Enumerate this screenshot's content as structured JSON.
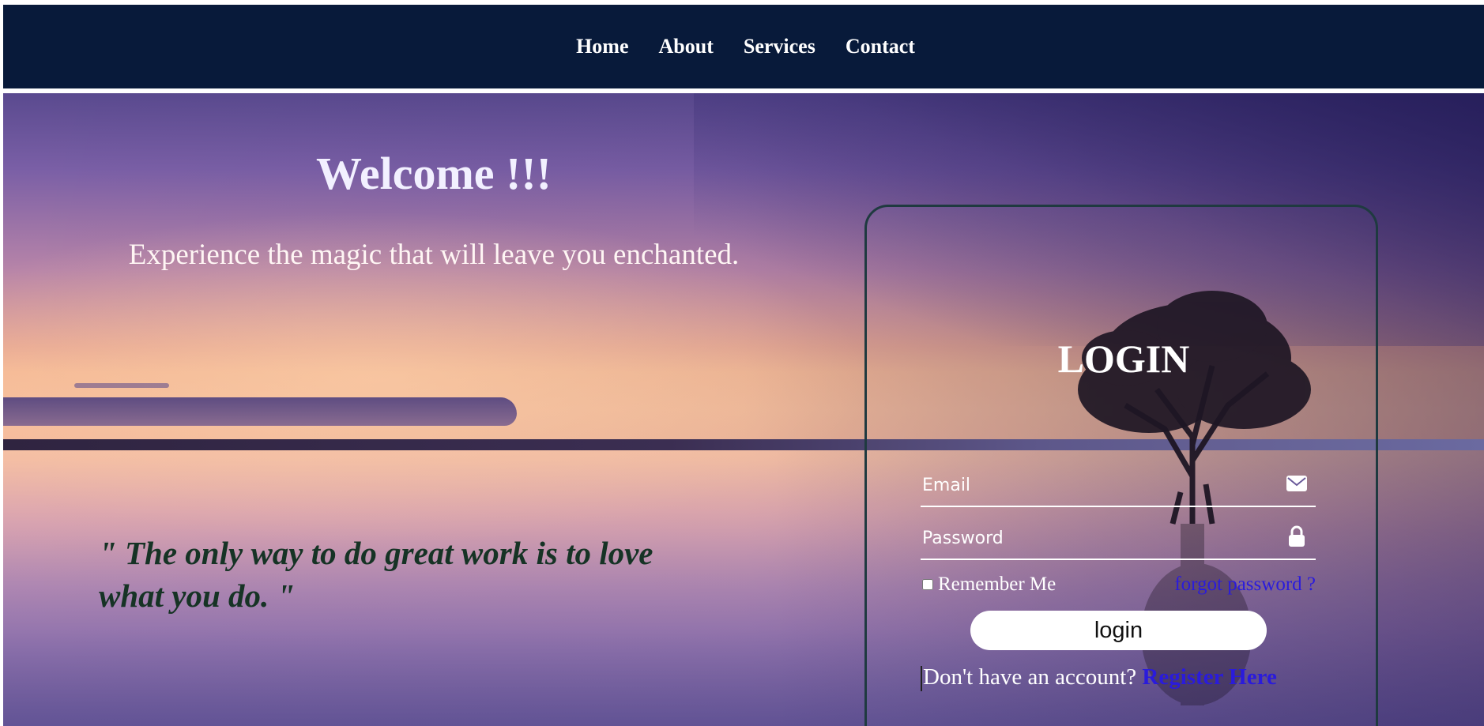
{
  "nav": {
    "items": [
      {
        "label": "Home"
      },
      {
        "label": "About"
      },
      {
        "label": "Services"
      },
      {
        "label": "Contact"
      }
    ]
  },
  "hero": {
    "title": "Welcome !!!",
    "tagline": "Experience the magic that will leave you enchanted.",
    "quote": "\" The only way to do great work is to love what you do. \""
  },
  "login": {
    "title": "LOGIN",
    "email_placeholder": "Email",
    "email_icon": "envelope-icon",
    "password_placeholder": "Password",
    "password_icon": "lock-icon",
    "remember_label": "Remember Me",
    "forgot_label": "forgot password ?",
    "button_label": "login",
    "register_prompt": "Don't have an account?",
    "register_link": "Register Here"
  },
  "colors": {
    "navbar": "#081a3a",
    "link": "#2a1bdc",
    "quote": "#163325",
    "card_border": "#1f3a40"
  }
}
